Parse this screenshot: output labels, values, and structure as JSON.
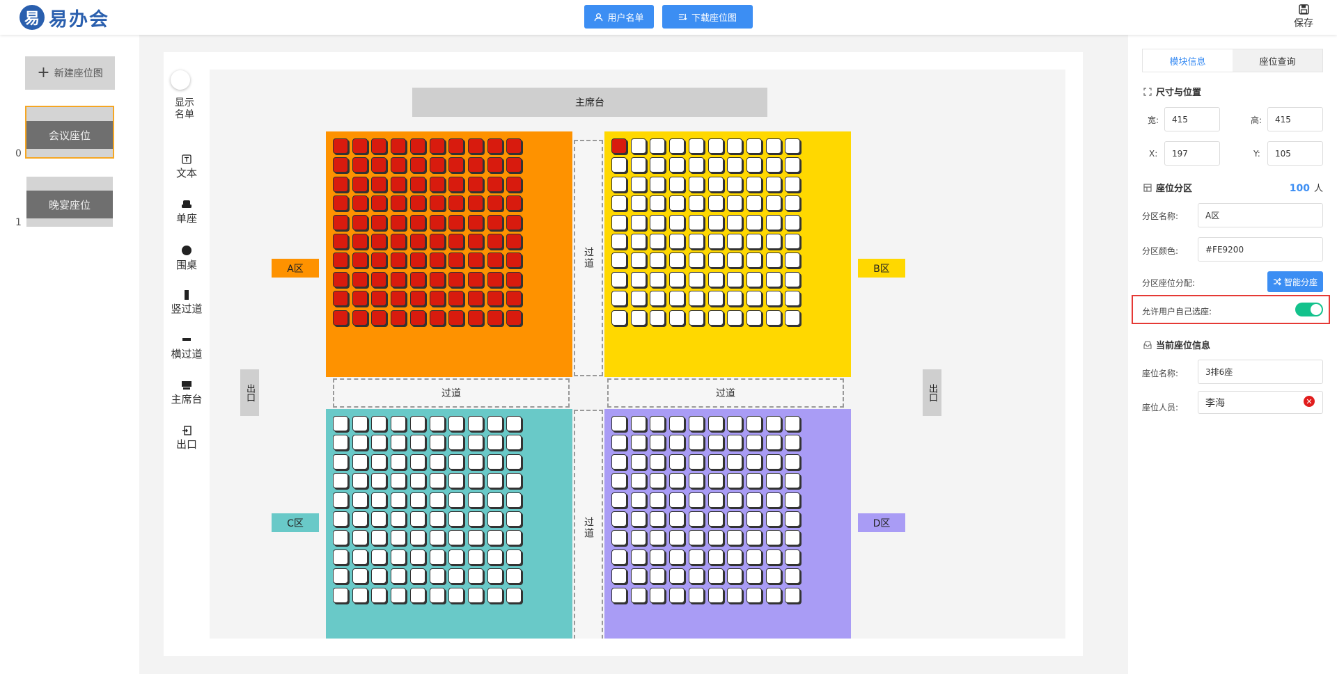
{
  "header": {
    "logo_mark": "易",
    "logo_text": "易办会",
    "btn_user_list": "用户名单",
    "btn_download": "下载座位图",
    "save_label": "保存"
  },
  "left": {
    "new_map": "新建座位图",
    "maps": [
      {
        "index": "0",
        "label": "会议座位"
      },
      {
        "index": "1",
        "label": "晚宴座位"
      }
    ]
  },
  "toolbar": {
    "show_list": "显示名单",
    "tools": [
      "文本",
      "单座",
      "围桌",
      "竖过道",
      "横过道",
      "主席台",
      "出口"
    ]
  },
  "canvas": {
    "stage": "主席台",
    "aisle": "过道",
    "exit": "出口",
    "zones": [
      {
        "name": "A区",
        "color": "#FE9200",
        "label_color": "#FE9200",
        "taken_rows": 10,
        "taken_first_row_cols": 10
      },
      {
        "name": "B区",
        "color": "#FFD800",
        "label_color": "#FFD800",
        "taken_rows": 0,
        "taken_first_row_cols": 1
      },
      {
        "name": "C区",
        "color": "#69C9C8",
        "label_color": "#69C9C8",
        "taken_rows": 0,
        "taken_first_row_cols": 0
      },
      {
        "name": "D区",
        "color": "#A99CF5",
        "label_color": "#A99CF5",
        "taken_rows": 0,
        "taken_first_row_cols": 0
      }
    ],
    "seat_cols": 10,
    "seat_rows": 10
  },
  "right": {
    "tab_module": "模块信息",
    "tab_query": "座位查询",
    "size_title": "尺寸与位置",
    "width_label": "宽:",
    "width_value": "415",
    "height_label": "高:",
    "height_value": "415",
    "x_label": "X:",
    "x_value": "197",
    "y_label": "Y:",
    "y_value": "105",
    "zone_title": "座位分区",
    "count": "100",
    "count_unit": "人",
    "zone_name_label": "分区名称:",
    "zone_name_value": "A区",
    "zone_color_label": "分区颜色:",
    "zone_color_value": "#FE9200",
    "zone_assign_label": "分区座位分配:",
    "smart_btn": "智能分座",
    "allow_label": "允许用户自己选座:",
    "allow_on": true,
    "seat_info_title": "当前座位信息",
    "seat_name_label": "座位名称:",
    "seat_name_value": "3排6座",
    "seat_person_label": "座位人员:",
    "seat_person_value": "李海"
  },
  "colors": {
    "primary": "#3C8EF3",
    "taken_seat": "#D81B0E",
    "switch_on": "#13C28C",
    "highlight": "#E53935"
  }
}
